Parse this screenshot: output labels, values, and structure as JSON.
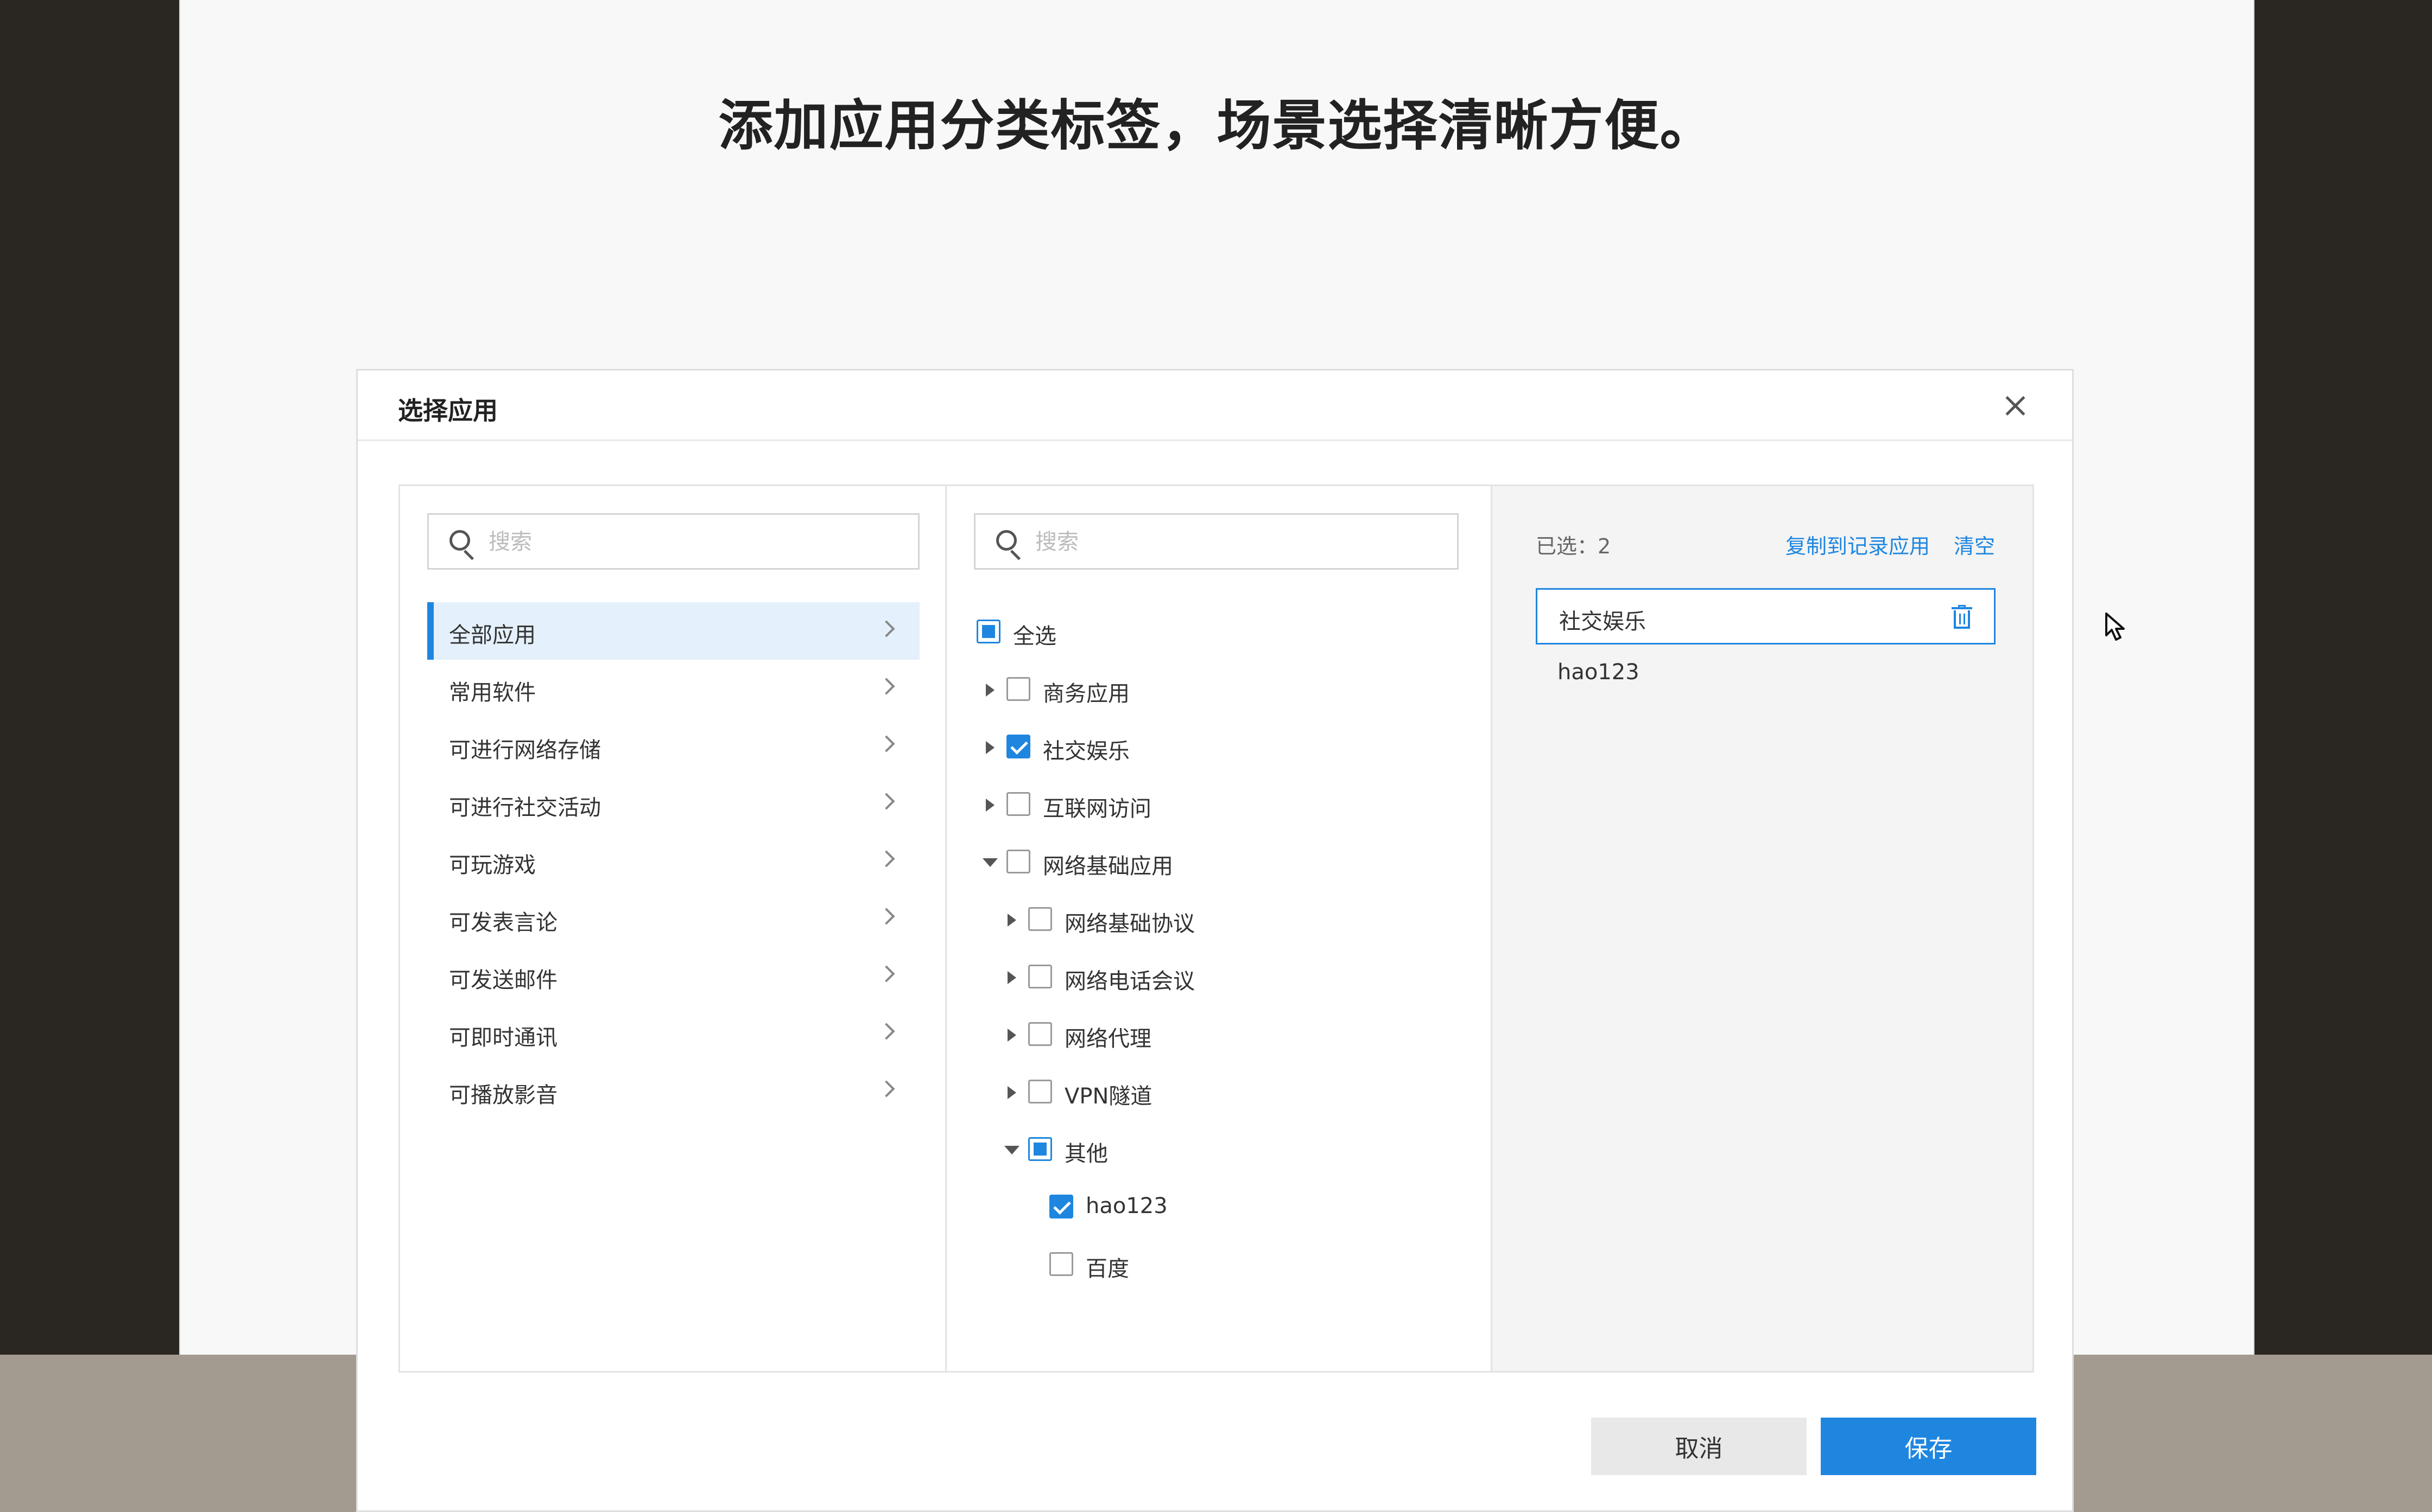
{
  "headline": "添加应用分类标签，场景选择清晰方便。",
  "dialog": {
    "title": "选择应用",
    "cancel_label": "取消",
    "save_label": "保存"
  },
  "left_panel": {
    "search_placeholder": "搜索",
    "categories": [
      {
        "label": "全部应用",
        "active": true
      },
      {
        "label": "常用软件"
      },
      {
        "label": "可进行网络存储"
      },
      {
        "label": "可进行社交活动"
      },
      {
        "label": "可玩游戏"
      },
      {
        "label": "可发表言论"
      },
      {
        "label": "可发送邮件"
      },
      {
        "label": "可即时通讯"
      },
      {
        "label": "可播放影音"
      }
    ]
  },
  "middle_panel": {
    "search_placeholder": "搜索",
    "tree": [
      {
        "label": "全选",
        "state": "partial"
      },
      {
        "label": "商务应用",
        "state": "unchecked",
        "expanded": false
      },
      {
        "label": "社交娱乐",
        "state": "checked",
        "expanded": false
      },
      {
        "label": "互联网访问",
        "state": "unchecked",
        "expanded": false
      },
      {
        "label": "网络基础应用",
        "state": "unchecked",
        "expanded": true
      },
      {
        "label": "网络基础协议",
        "state": "unchecked",
        "expanded": false
      },
      {
        "label": "网络电话会议",
        "state": "unchecked",
        "expanded": false
      },
      {
        "label": "网络代理",
        "state": "unchecked",
        "expanded": false
      },
      {
        "label": "VPN隧道",
        "state": "unchecked",
        "expanded": false
      },
      {
        "label": "其他",
        "state": "partial",
        "expanded": true
      },
      {
        "label": "hao123",
        "state": "checked"
      },
      {
        "label": "百度",
        "state": "unchecked"
      }
    ]
  },
  "right_panel": {
    "selected_count": "已选：2",
    "copy_link": "复制到记录应用",
    "clear_link": "清空",
    "selected_items": [
      {
        "label": "社交娱乐"
      },
      {
        "label": "hao123"
      }
    ]
  },
  "colors": {
    "accent": "#1f86e0",
    "active_row_bg": "#e4f1fc",
    "dark_bg": "#2a2622",
    "bottom_bg": "#a39b8f"
  },
  "icons": [
    "search-icon",
    "chevron-right-icon",
    "caret-right-icon",
    "caret-down-icon",
    "trash-icon",
    "close-icon",
    "mouse-cursor-icon"
  ]
}
